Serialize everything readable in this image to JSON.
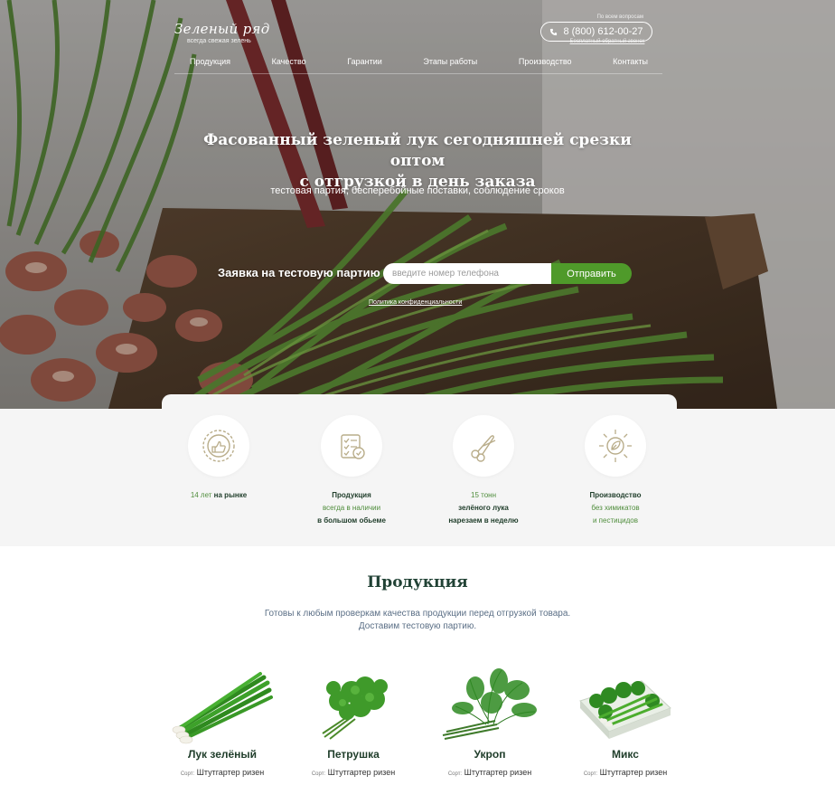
{
  "header": {
    "logo_title": "Зеленый ряд",
    "logo_subtitle": "всегда свежая зелень",
    "contacts_hint": "По всем вопросам",
    "phone": "8 (800) 612-00-27",
    "callback_link": "Бесплатный обратный звонок"
  },
  "nav": {
    "items": [
      "Продукция",
      "Качество",
      "Гарантии",
      "Этапы работы",
      "Производство",
      "Контакты"
    ]
  },
  "hero": {
    "headline_line1": "Фасованный зеленый лук сегодняшней срезки оптом",
    "headline_line2": "с отгрузкой в день заказа",
    "subline": "тестовая партия, бесперебойные поставки, соблюдение сроков",
    "form_label": "Заявка на тестовую партию",
    "phone_placeholder": "введите номер телефона",
    "submit_label": "Отправить",
    "privacy_link": "Политика конфиденциальности"
  },
  "features": [
    {
      "icon": "quality-seal-icon",
      "lines": [
        [
          "14 лет ",
          "на рынке"
        ]
      ]
    },
    {
      "icon": "checklist-icon",
      "lines": [
        [
          "",
          "Продукция"
        ],
        [
          "всегда в наличии",
          ""
        ],
        [
          "",
          "в большом обьеме"
        ]
      ]
    },
    {
      "icon": "pruning-shears-icon",
      "lines": [
        [
          "15 тонн",
          ""
        ],
        [
          "",
          "зелёного лука"
        ],
        [
          "",
          "нарезаем в неделю"
        ]
      ]
    },
    {
      "icon": "eco-sun-leaf-icon",
      "lines": [
        [
          "",
          "Производство"
        ],
        [
          "без химикатов",
          ""
        ],
        [
          "и пестицидов",
          ""
        ]
      ]
    }
  ],
  "products_section": {
    "title": "Продукция",
    "desc_line1": "Готовы к любым проверкам качества продукции перед отгрузкой товара.",
    "desc_line2": "Доставим тестовую партию."
  },
  "products": [
    {
      "name": "Лук зелёный",
      "variety_prefix": "Сорт:",
      "variety": "Штутгартер ризен",
      "icon": "green-onion-bunch-icon"
    },
    {
      "name": "Петрушка",
      "variety_prefix": "Сорт:",
      "variety": "Штутгартер ризен",
      "icon": "parsley-bunch-icon"
    },
    {
      "name": "Укроп",
      "variety_prefix": "Сорт:",
      "variety": "Штутгартер ризен",
      "icon": "dill-bunch-icon"
    },
    {
      "name": "Микс",
      "variety_prefix": "Сорт:",
      "variety": "Штутгартер ризен",
      "icon": "greens-mix-tray-icon"
    }
  ],
  "colors": {
    "accent_green": "#4f9a2a",
    "dark_green_text": "#214235",
    "feature_bg": "#f5f5f5"
  }
}
